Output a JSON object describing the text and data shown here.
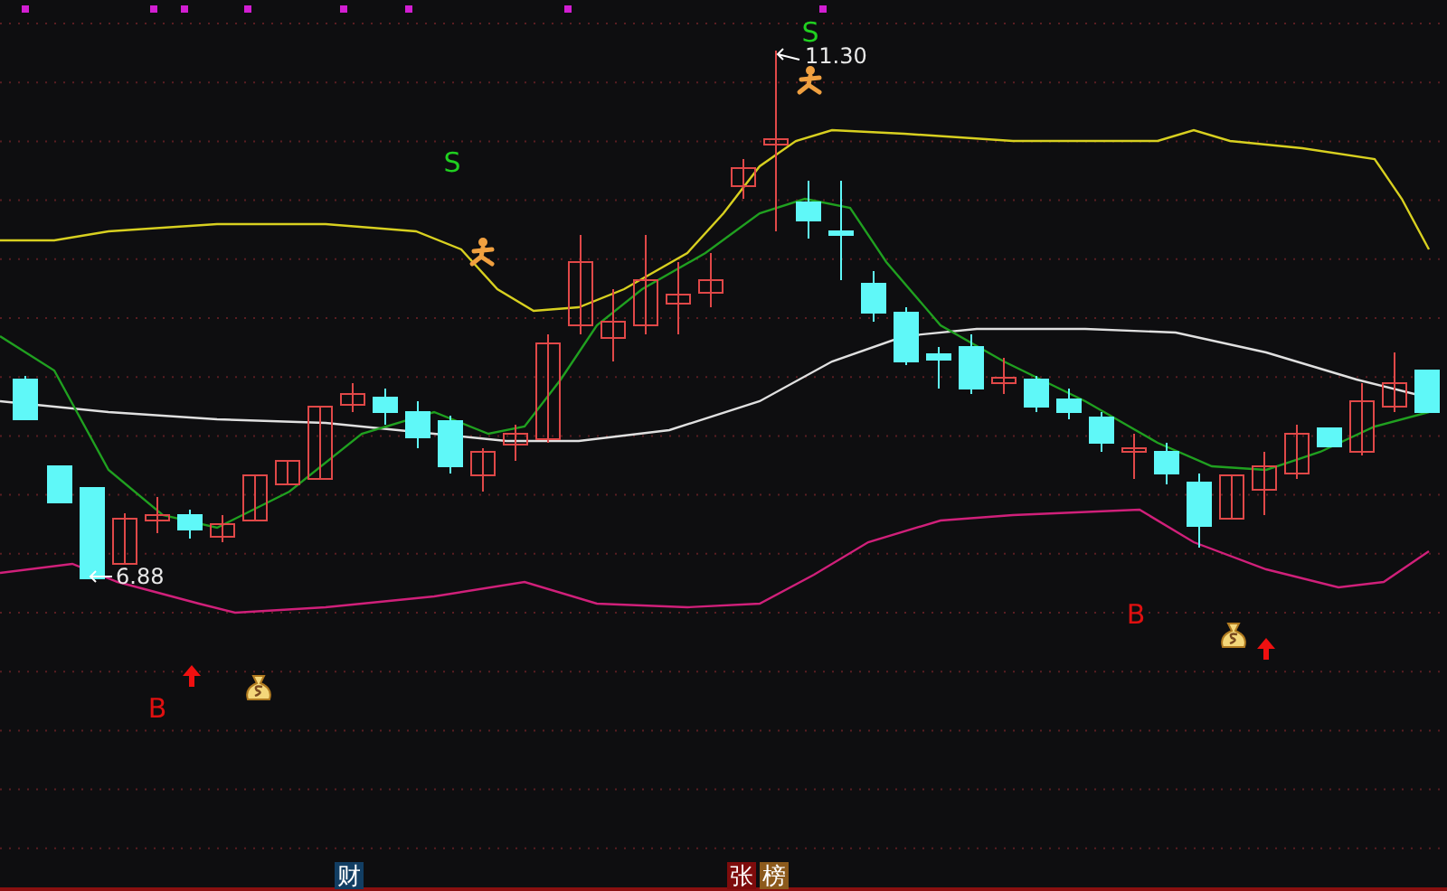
{
  "signals": [
    {
      "kind": "sell",
      "label": "S"
    },
    {
      "kind": "sell",
      "label": "S"
    },
    {
      "kind": "buy",
      "label": "B"
    },
    {
      "kind": "buy",
      "label": "B"
    }
  ],
  "price_marks": [
    {
      "kind": "high",
      "text": "11.30"
    },
    {
      "kind": "low",
      "text": "6.88"
    }
  ],
  "tags": [
    {
      "text": "财",
      "color": "#123e63"
    },
    {
      "text": "张",
      "color": "#7e0c0c"
    },
    {
      "text": "榜",
      "color": "#8c5a1c"
    }
  ]
}
